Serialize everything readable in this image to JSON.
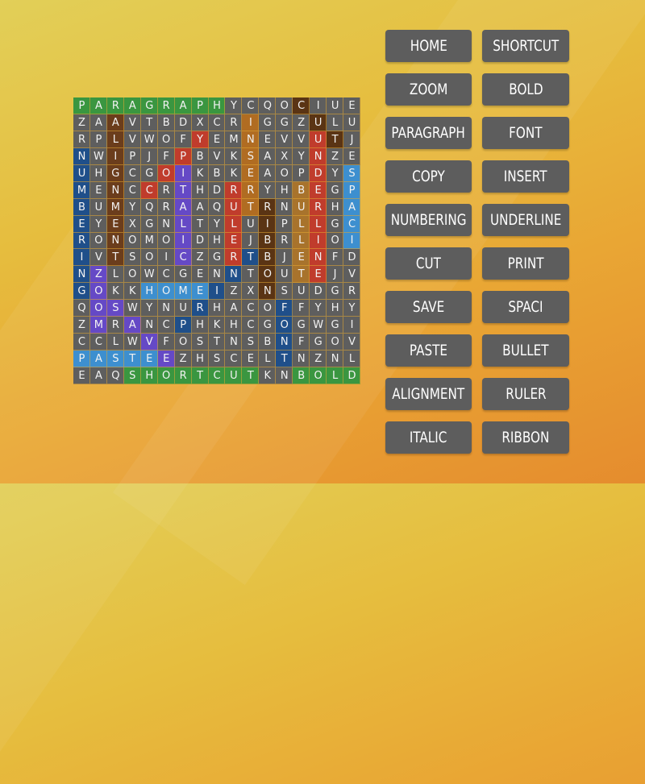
{
  "grid": {
    "rows": [
      "PARAGRAPHYCQOCIUE",
      "ZAAVTBDXCRIGGZULU",
      "RPLVWOFYEMNEVVUTJ",
      "NWIPJFPBVKSAXYNZE",
      "UHGCGOIKBKEAOPDYS",
      "MENCCRTHDRRYHBEGP",
      "BUMYQRAAQUTRNURHA",
      "EYEXGNLTYLUIPLLGC",
      "RONOMOIDHEJBRLIOI",
      "IVTSOICZGRTBJENFD",
      "NZLOWCGENNTOUTEJV",
      "GOKKHOMEIZXNSUDGR",
      "QOSWYNURHACOFFYHY",
      "ZMRANCPHKHCGOGWGI",
      "CCLWVFOSTNSBNFGOV",
      "PASTEEZHSCELTNZNL",
      "EAQSHORTCUTKNBOLD"
    ],
    "found": [
      {
        "word": "PARAGRAPH",
        "row": 0,
        "col": 0,
        "dir": "right",
        "color": "#3a9640"
      },
      {
        "word": "SHORTCUT",
        "row": 16,
        "col": 3,
        "dir": "right",
        "color": "#3a9640"
      },
      {
        "word": "BOLD",
        "row": 16,
        "col": 13,
        "dir": "right",
        "color": "#3a9640"
      },
      {
        "word": "ALIGNMENT",
        "row": 1,
        "col": 2,
        "dir": "down",
        "color": "#6b3d1c"
      },
      {
        "word": "INSERT",
        "row": 1,
        "col": 10,
        "dir": "down",
        "color": "#b06c22"
      },
      {
        "word": "BULLET",
        "row": 5,
        "col": 13,
        "dir": "down",
        "color": "#a8732c"
      },
      {
        "word": "CUT",
        "row": 0,
        "col": 13,
        "dir": "down-right",
        "color": "#5a3414"
      },
      {
        "word": "UNDERLINE",
        "row": 2,
        "col": 14,
        "dir": "down",
        "color": "#c03c2c"
      },
      {
        "word": "RULER",
        "row": 5,
        "col": 9,
        "dir": "down",
        "color": "#c03c2c"
      },
      {
        "word": "COPY",
        "row": 5,
        "col": 4,
        "dir": "up-right",
        "color": "#c03c2c"
      },
      {
        "word": "NUMBERING",
        "row": 3,
        "col": 0,
        "dir": "down",
        "color": "#1f4f8a"
      },
      {
        "word": "PRINT",
        "row": 13,
        "col": 6,
        "dir": "up-right",
        "color": "#1f4f8a"
      },
      {
        "word": "FONT",
        "row": 12,
        "col": 12,
        "dir": "down",
        "color": "#1f4f8a"
      },
      {
        "word": "HOME",
        "row": 11,
        "col": 4,
        "dir": "right",
        "color": "#3d8fcf"
      },
      {
        "word": "PASTE",
        "row": 15,
        "col": 0,
        "dir": "right",
        "color": "#3d8fcf"
      },
      {
        "word": "SPACI",
        "row": 4,
        "col": 16,
        "dir": "down",
        "color": "#3d8fcf"
      },
      {
        "word": "ITALIC",
        "row": 4,
        "col": 6,
        "dir": "down",
        "color": "#6549c6"
      },
      {
        "word": "ZOOM",
        "row": 10,
        "col": 1,
        "dir": "down",
        "color": "#6549c6"
      },
      {
        "word": "SAVE",
        "row": 12,
        "col": 2,
        "dir": "down-right",
        "color": "#6549c6"
      },
      {
        "word": "RIBBON",
        "row": 6,
        "col": 11,
        "dir": "down",
        "color": "#5a3414"
      }
    ]
  },
  "word_list": [
    "HOME",
    "SHORTCUT",
    "ZOOM",
    "BOLD",
    "PARAGRAPH",
    "FONT",
    "COPY",
    "INSERT",
    "NUMBERING",
    "UNDERLINE",
    "CUT",
    "PRINT",
    "SAVE",
    "SPACI",
    "PASTE",
    "BULLET",
    "ALIGNMENT",
    "RULER",
    "ITALIC",
    "RIBBON"
  ]
}
